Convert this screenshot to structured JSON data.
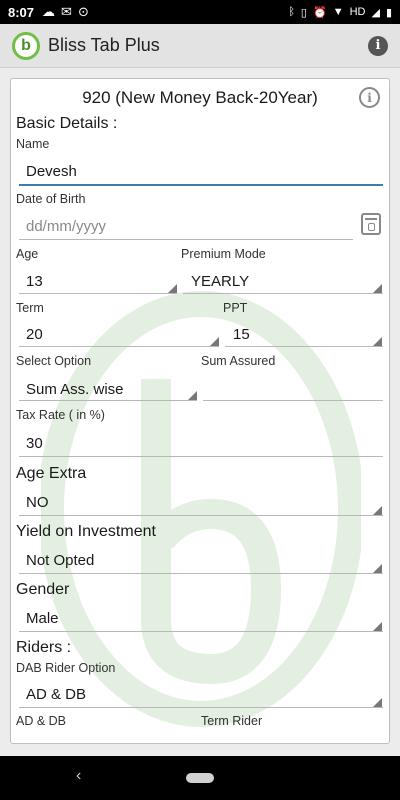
{
  "status": {
    "time": "8:07",
    "network": "HD"
  },
  "app": {
    "title": "Bliss Tab Plus",
    "logo_letter": "b"
  },
  "plan": {
    "title": "920 (New Money Back-20Year)"
  },
  "sections": {
    "basic": "Basic Details :",
    "age_extra": "Age Extra",
    "yield": "Yield on Investment",
    "gender": "Gender",
    "riders": "Riders :"
  },
  "fields": {
    "name": {
      "label": "Name",
      "value": "Devesh"
    },
    "dob": {
      "label": "Date of Birth",
      "placeholder": "dd/mm/yyyy"
    },
    "age": {
      "label": "Age",
      "value": "13"
    },
    "premium_mode": {
      "label": "Premium Mode",
      "value": "YEARLY"
    },
    "term": {
      "label": "Term",
      "value": "20"
    },
    "ppt": {
      "label": "PPT",
      "value": "15"
    },
    "select_option": {
      "label": "Select Option",
      "value": "Sum Ass. wise"
    },
    "sum_assured": {
      "label": "Sum Assured",
      "value": ""
    },
    "tax_rate": {
      "label": "Tax Rate ( in %)",
      "value": "30"
    },
    "age_extra": {
      "value": "NO"
    },
    "yield": {
      "value": "Not Opted"
    },
    "gender": {
      "value": "Male"
    },
    "dab_rider": {
      "label": "DAB Rider Option",
      "value": "AD & DB"
    },
    "ad_db": {
      "label": "AD & DB"
    },
    "term_rider": {
      "label": "Term Rider"
    }
  },
  "icons": {
    "app_info": "info-icon",
    "plan_info": "info-circle-icon",
    "calendar": "calendar-icon",
    "dropdown": "dropdown-triangle-icon"
  },
  "colors": {
    "accent": "#3a7fa6",
    "logo_green": "#6fbf45"
  }
}
